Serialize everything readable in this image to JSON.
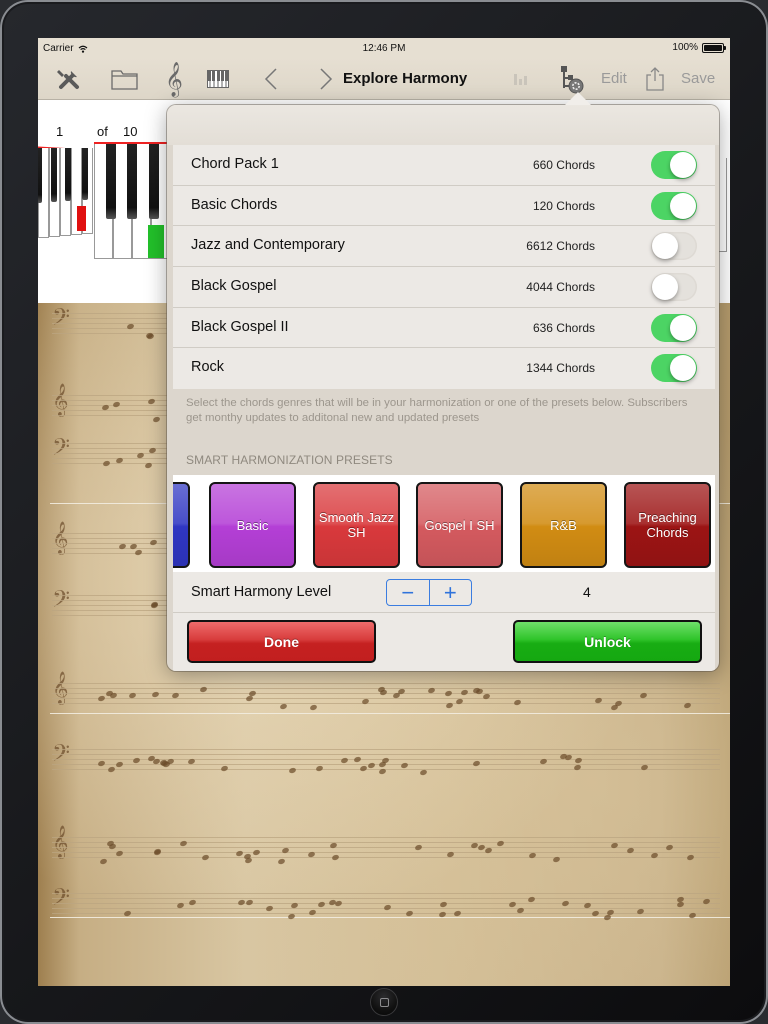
{
  "status_bar": {
    "carrier": "Carrier",
    "time": "12:46 PM",
    "battery": "100%"
  },
  "nav_bar": {
    "title": "Explore Harmony",
    "edit_label": "Edit",
    "save_label": "Save",
    "icons": [
      "tools-icon",
      "folder-icon",
      "treble-clef-icon",
      "piano-keyboard-icon",
      "chevron-left-icon",
      "chevron-right-icon",
      "bar-chart-icon",
      "harmony-settings-icon",
      "share-icon"
    ]
  },
  "page_indicator": {
    "current": "1",
    "of_label": "of",
    "total": "10"
  },
  "popover": {
    "genres": [
      {
        "name": "Chord Pack 1",
        "count": "660 Chords",
        "enabled": true
      },
      {
        "name": "Basic Chords",
        "count": "120 Chords",
        "enabled": true
      },
      {
        "name": "Jazz and Contemporary",
        "count": "6612 Chords",
        "enabled": false
      },
      {
        "name": "Black Gospel",
        "count": "4044 Chords",
        "enabled": false
      },
      {
        "name": "Black Gospel II",
        "count": "636 Chords",
        "enabled": true
      },
      {
        "name": "Rock",
        "count": "1344 Chords",
        "enabled": true
      }
    ],
    "help_text": "Select the chords genres that will be in your harmonization or one of the presets below. Subscribers get monthy updates to additonal new and updated presets",
    "presets_header": "SMART HARMONIZATION PRESETS",
    "presets": [
      {
        "label": "",
        "color": "#2f36c2"
      },
      {
        "label": "Basic",
        "color": "#b43fd6"
      },
      {
        "label": "Smooth Jazz SH",
        "color": "#d9393c"
      },
      {
        "label": "Gospel I SH",
        "color": "#d45a5f"
      },
      {
        "label": "R&B",
        "color": "#d18c13"
      },
      {
        "label": "Preaching Chords",
        "color": "#9c1414"
      }
    ],
    "level": {
      "label": "Smart Harmony Level",
      "minus": "−",
      "plus": "+",
      "value": "4"
    },
    "done_label": "Done",
    "unlock_label": "Unlock"
  },
  "colors": {
    "toggle_on": "#4cd464",
    "stepper_blue": "#2f73db",
    "done_red": "#c52121",
    "unlock_green": "#18ad13",
    "highlight_key_red": "#e01010",
    "highlight_key_green": "#22c02a"
  }
}
